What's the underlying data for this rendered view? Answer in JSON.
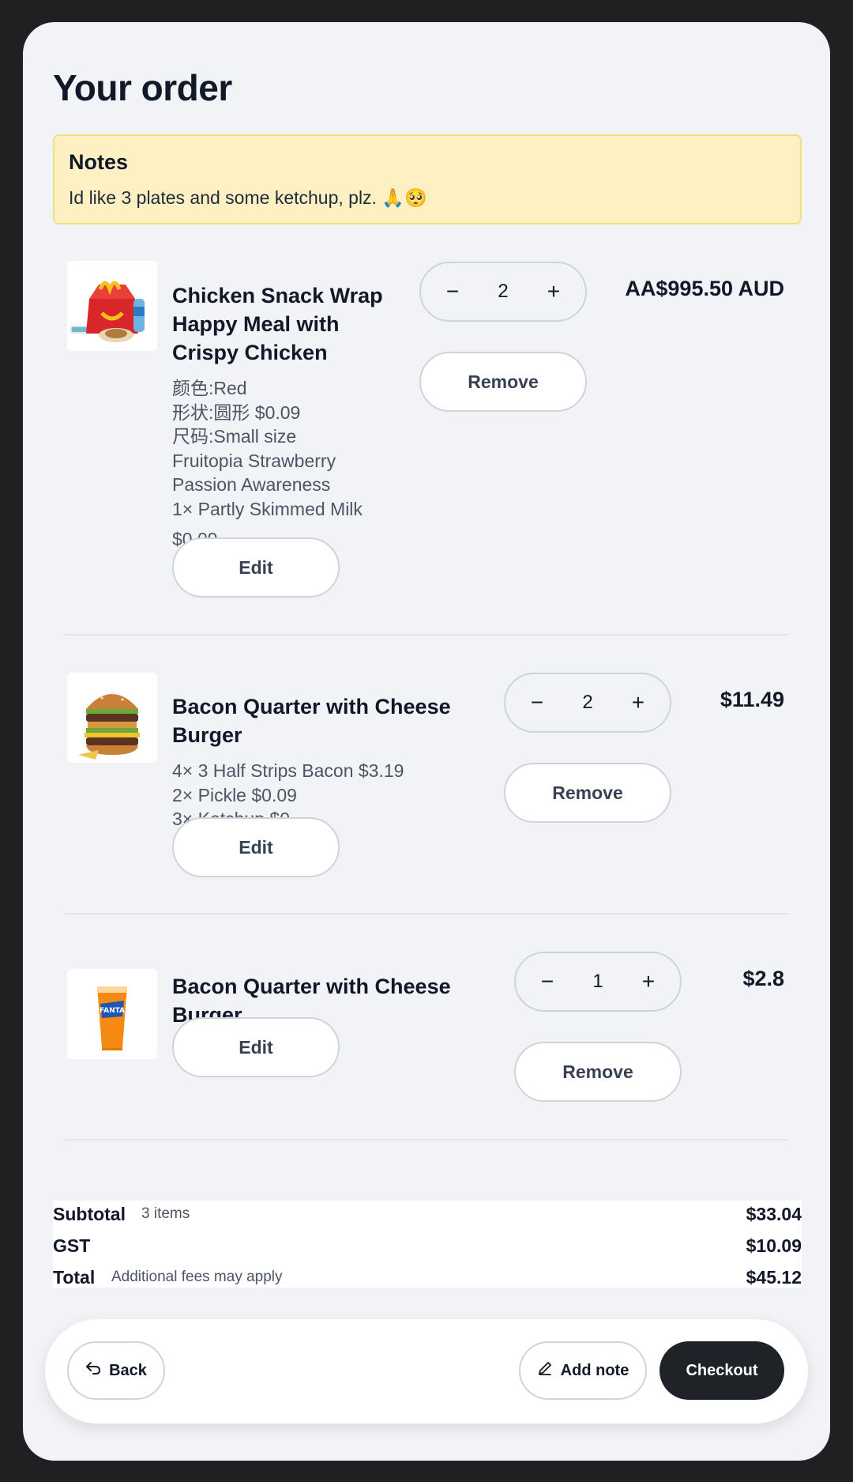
{
  "page": {
    "title": "Your order"
  },
  "notes": {
    "title": "Notes",
    "text": "Id like 3 plates and some ketchup, plz. 🙏🥺"
  },
  "items": [
    {
      "name_lines": [
        "Chicken Snack Wrap",
        "Happy Meal with",
        "Crispy Chicken"
      ],
      "options": [
        "颜色:Red",
        "形状:圆形  $0.09",
        "尺码:Small size",
        "Fruitopia Strawberry",
        "Passion Awareness",
        "1×  Partly Skimmed Milk"
      ],
      "unit_price": "$0.09",
      "quantity": "2",
      "line_price": "AA$995.50 AUD",
      "edit_label": "Edit",
      "remove_label": "Remove",
      "image": "happy-meal-image"
    },
    {
      "name_lines": [
        "Bacon Quarter with Cheese",
        "Burger"
      ],
      "options": [
        "4×  3 Half Strips Bacon  $3.19",
        "2×  Pickle  $0.09",
        "3×  Ketchup  $0"
      ],
      "quantity": "2",
      "line_price": "$11.49",
      "edit_label": "Edit",
      "remove_label": "Remove",
      "image": "burger-image"
    },
    {
      "name_lines": [
        "Bacon Quarter with Cheese",
        "Burger"
      ],
      "options": [],
      "quantity": "1",
      "line_price": "$2.8",
      "edit_label": "Edit",
      "remove_label": "Remove",
      "image": "fanta-drink-image"
    }
  ],
  "stepper": {
    "minus": "−",
    "plus": "+"
  },
  "summary": {
    "subtotal_label": "Subtotal",
    "subtotal_sub": "3 items",
    "subtotal_value": "$33.04",
    "gst_label": "GST",
    "gst_value": "$10.09",
    "total_label": "Total",
    "total_sub": "Additional fees may apply",
    "total_value": "$45.12"
  },
  "actions": {
    "back_label": "Back",
    "add_note_label": "Add note",
    "checkout_label": "Checkout"
  },
  "colors": {
    "background": "#f1f3f7",
    "notes_bg": "#fdf1c4",
    "notes_border": "#f3dd7c",
    "dark_button": "#1f2328"
  }
}
